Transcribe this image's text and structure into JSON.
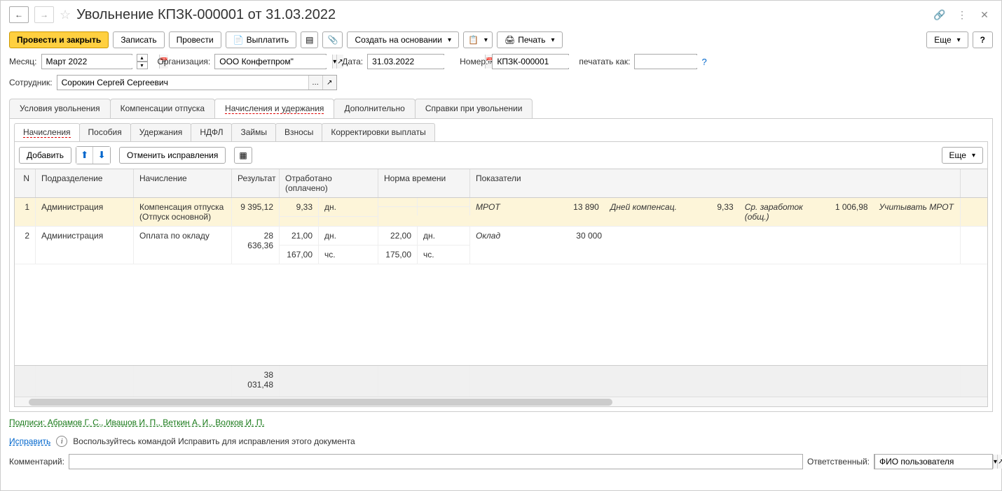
{
  "title": "Увольнение КПЗК-000001 от 31.03.2022",
  "toolbar": {
    "post_close": "Провести и закрыть",
    "write": "Записать",
    "post": "Провести",
    "pay": "Выплатить",
    "create_based": "Создать на основании",
    "print": "Печать",
    "more": "Еще",
    "help": "?"
  },
  "form": {
    "month_label": "Месяц:",
    "month": "Март 2022",
    "org_label": "Организация:",
    "org": "ООО Конфетпром\"",
    "date_label": "Дата:",
    "date": "31.03.2022",
    "number_label": "Номер:",
    "number": "КПЗК-000001",
    "print_as_label": "печатать как:",
    "print_as": "",
    "employee_label": "Сотрудник:",
    "employee": "Сорокин Сергей Сергеевич"
  },
  "main_tabs": [
    "Условия увольнения",
    "Компенсации отпуска",
    "Начисления и удержания",
    "Дополнительно",
    "Справки при увольнении"
  ],
  "sub_tabs": [
    "Начисления",
    "Пособия",
    "Удержания",
    "НДФЛ",
    "Займы",
    "Взносы",
    "Корректировки выплаты"
  ],
  "subtoolbar": {
    "add": "Добавить",
    "cancel_fix": "Отменить исправления",
    "more": "Еще"
  },
  "table": {
    "headers": {
      "n": "N",
      "dept": "Подразделение",
      "accr": "Начисление",
      "result": "Результат",
      "worked": "Отработано (оплачено)",
      "norm": "Норма времени",
      "ind": "Показатели"
    },
    "rows": [
      {
        "n": "1",
        "dept": "Администрация",
        "accr": "Компенсация отпуска (Отпуск основной)",
        "result": "9 395,12",
        "worked_v": "9,33",
        "worked_u": "дн.",
        "norm_v": "",
        "norm_u": "",
        "indicators": [
          {
            "l": "МРОТ",
            "v": "13 890"
          },
          {
            "l": "Дней компенсац.",
            "v": "9,33"
          },
          {
            "l": "Ср. заработок (общ.)",
            "v": "1 006,98"
          },
          {
            "l": "Учитывать МРОТ",
            "v": ""
          }
        ]
      },
      {
        "n": "2",
        "dept": "Администрация",
        "accr": "Оплата по окладу",
        "result": "28 636,36",
        "worked_v": "21,00",
        "worked_u": "дн.",
        "worked_v2": "167,00",
        "worked_u2": "чс.",
        "norm_v": "22,00",
        "norm_u": "дн.",
        "norm_v2": "175,00",
        "norm_u2": "чс.",
        "indicators": [
          {
            "l": "Оклад",
            "v": "30 000"
          }
        ]
      }
    ],
    "total": "38 031,48"
  },
  "signatures_label": "Подписи: Абрамов Г. С., Ивашов И. П., Веткин А. И., Волков И. П.",
  "fix_label": "Исправить",
  "fix_hint": "Воспользуйтесь командой Исправить для исправления этого документа",
  "comment_label": "Комментарий:",
  "responsible_label": "Ответственный:",
  "responsible": "ФИО пользователя"
}
